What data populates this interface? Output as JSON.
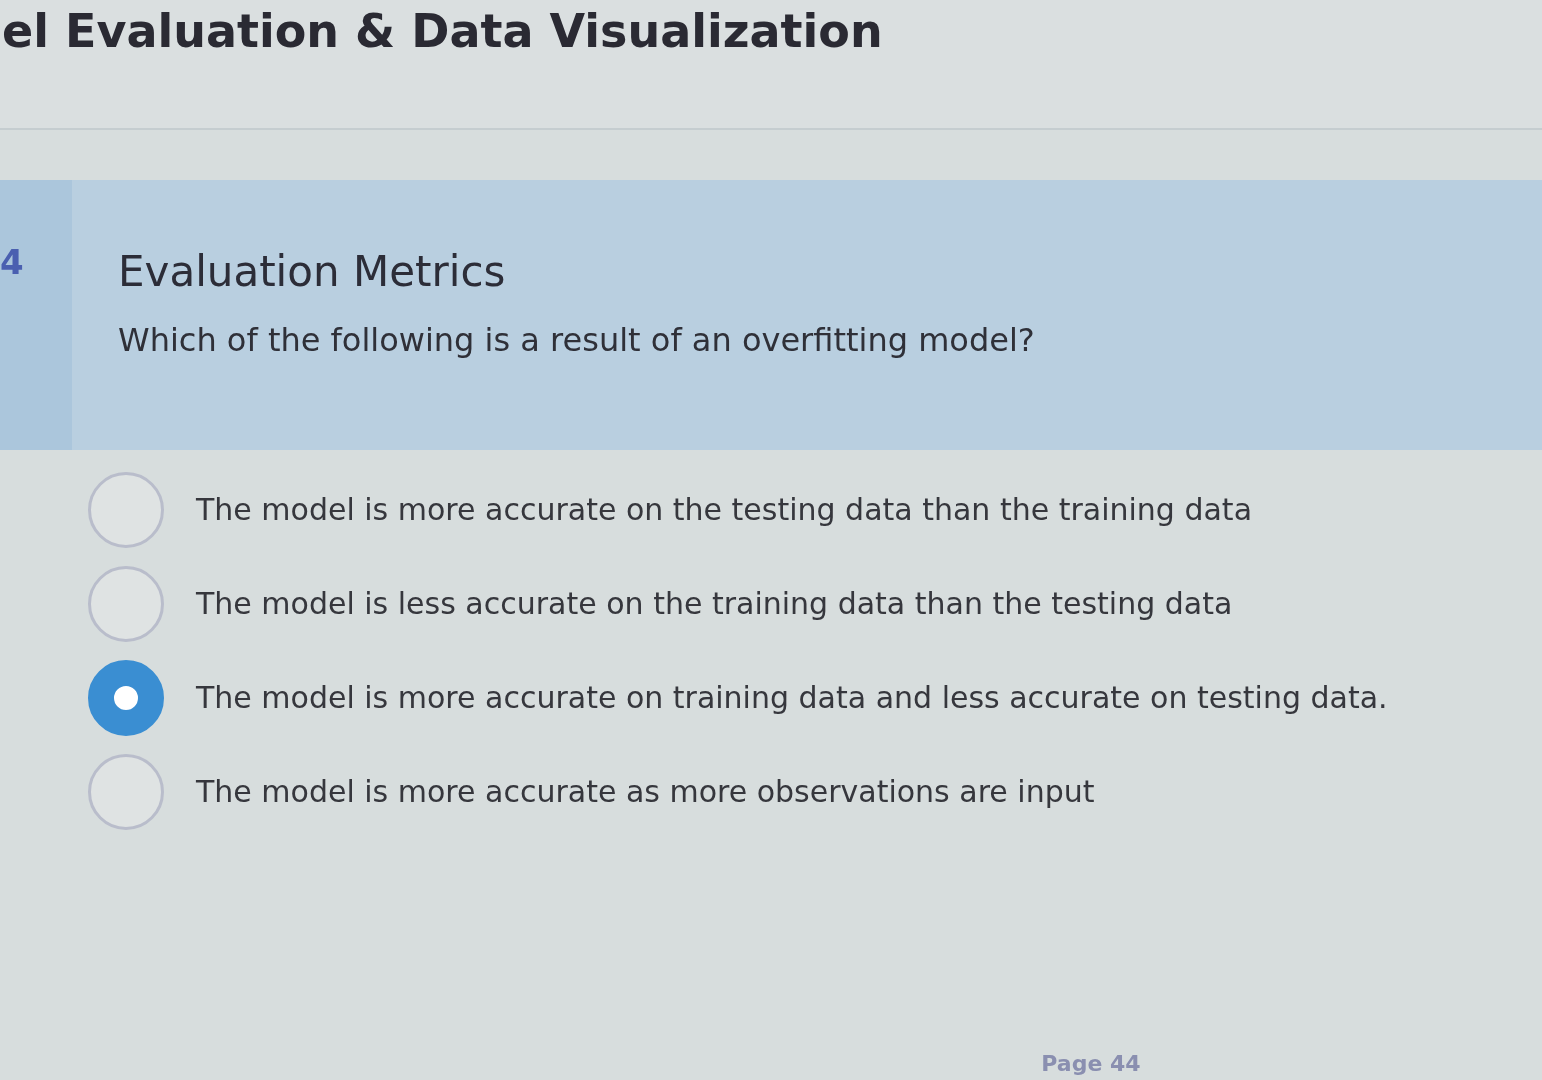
{
  "header": {
    "title": "el Evaluation & Data Visualization"
  },
  "question": {
    "number": "4",
    "title": "Evaluation Metrics",
    "text": "Which of the following is a result of an overfitting model?",
    "options": [
      {
        "label": "The model is more accurate on the testing data than the training data",
        "selected": false
      },
      {
        "label": "The model is less accurate on the training data than the testing data",
        "selected": false
      },
      {
        "label": "The model is more accurate on training data and less accurate on testing data.",
        "selected": true
      },
      {
        "label": "The model is more accurate as more observations are input",
        "selected": false
      }
    ]
  },
  "footer": {
    "page": "Page 44"
  }
}
